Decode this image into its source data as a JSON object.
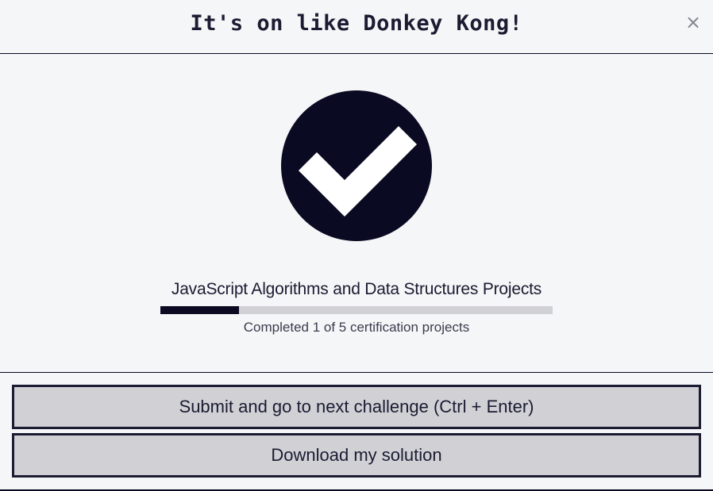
{
  "modal": {
    "title": "It's on like Donkey Kong!",
    "close_label": "×"
  },
  "body": {
    "icon": "check-circle-icon",
    "project_title": "JavaScript Algorithms and Data Structures Projects",
    "progress": {
      "completed": 1,
      "total": 5,
      "fraction": 0.2,
      "text": "Completed 1 of 5 certification projects"
    }
  },
  "footer": {
    "submit_label": "Submit and go to next challenge (Ctrl + Enter)",
    "download_label": "Download my solution"
  },
  "colors": {
    "primary": "#0a0a23",
    "button_bg": "#d0d0d5",
    "background": "#f5f6f7",
    "icon_check": "#ffffff"
  }
}
